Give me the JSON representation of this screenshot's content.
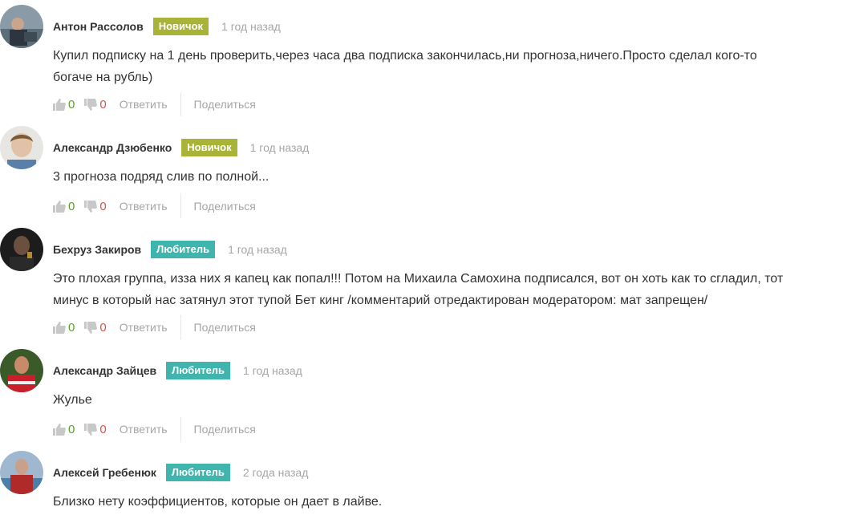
{
  "colors": {
    "badge_newbie": "#a9b337",
    "badge_amateur": "#3fb5ad",
    "like_count": "#5aa02c",
    "dislike_count": "#d9534f",
    "muted": "#a6a6a6"
  },
  "actions": {
    "reply_label": "Ответить",
    "share_label": "Поделиться"
  },
  "icons": {
    "like": "thumbs-up-icon",
    "dislike": "thumbs-down-icon"
  },
  "comments": [
    {
      "author": "Антон Рассолов",
      "badge": "Новичок",
      "time": "1 год назад",
      "lines": [
        "Купил подписку на 1 день проверить,через часа два подписка закончилась,ни прогноза,ничего.Просто сделал кого-то",
        "богаче на рубль)"
      ],
      "likes": "0",
      "dislikes": "0"
    },
    {
      "author": "Александр Дзюбенко",
      "badge": "Новичок",
      "time": "1 год назад",
      "lines": [
        "3 прогноза подряд слив по полной..."
      ],
      "likes": "0",
      "dislikes": "0"
    },
    {
      "author": "Бехруз Закиров",
      "badge": "Любитель",
      "time": "1 год назад",
      "lines": [
        "Это плохая группа, изза них я капец как попал!!! Потом на Михаила Самохина подписался, вот он хоть как то сгладил, тот",
        "минус в который нас затянул этот тупой Бет кинг /комментарий отредактирован модератором: мат запрещен/"
      ],
      "likes": "0",
      "dislikes": "0"
    },
    {
      "author": "Александр Зайцев",
      "badge": "Любитель",
      "time": "1 год назад",
      "lines": [
        "Жулье"
      ],
      "likes": "0",
      "dislikes": "0"
    },
    {
      "author": "Алексей Гребенюк",
      "badge": "Любитель",
      "time": "2 года назад",
      "lines": [
        "Близко нету коэффициентов, которые он дает в лайве."
      ]
    }
  ]
}
